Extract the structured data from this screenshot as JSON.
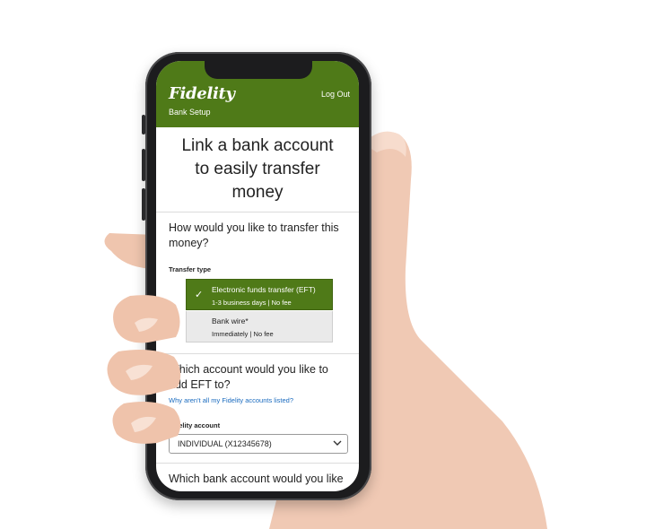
{
  "header": {
    "logo_text": "Fidelity",
    "logout_label": "Log Out",
    "subtitle": "Bank Setup",
    "accent_color": "#4f7a18"
  },
  "main": {
    "headline_lines": [
      "Link a bank account",
      "to easily transfer",
      "money"
    ],
    "transfer_question_lines": [
      "How would you like to transfer this",
      "money?"
    ],
    "transfer_type_label": "Transfer type",
    "options": [
      {
        "title": "Electronic funds transfer (EFT)",
        "subtitle": "1-3 business days | No fee",
        "selected": true
      },
      {
        "title": "Bank wire*",
        "subtitle": "Immediately | No fee",
        "selected": false
      }
    ],
    "account_question_lines": [
      "Which account would you like to",
      "add EFT to?"
    ],
    "accounts_link": "Why aren't all my Fidelity accounts listed?",
    "account_label": "Fidelity account",
    "account_value": "INDIVIDUAL (X12345678)",
    "bank_question_partial": "Which bank account would you like"
  },
  "icons": {
    "check": "check-icon",
    "dropdown": "chevron-down-icon"
  }
}
